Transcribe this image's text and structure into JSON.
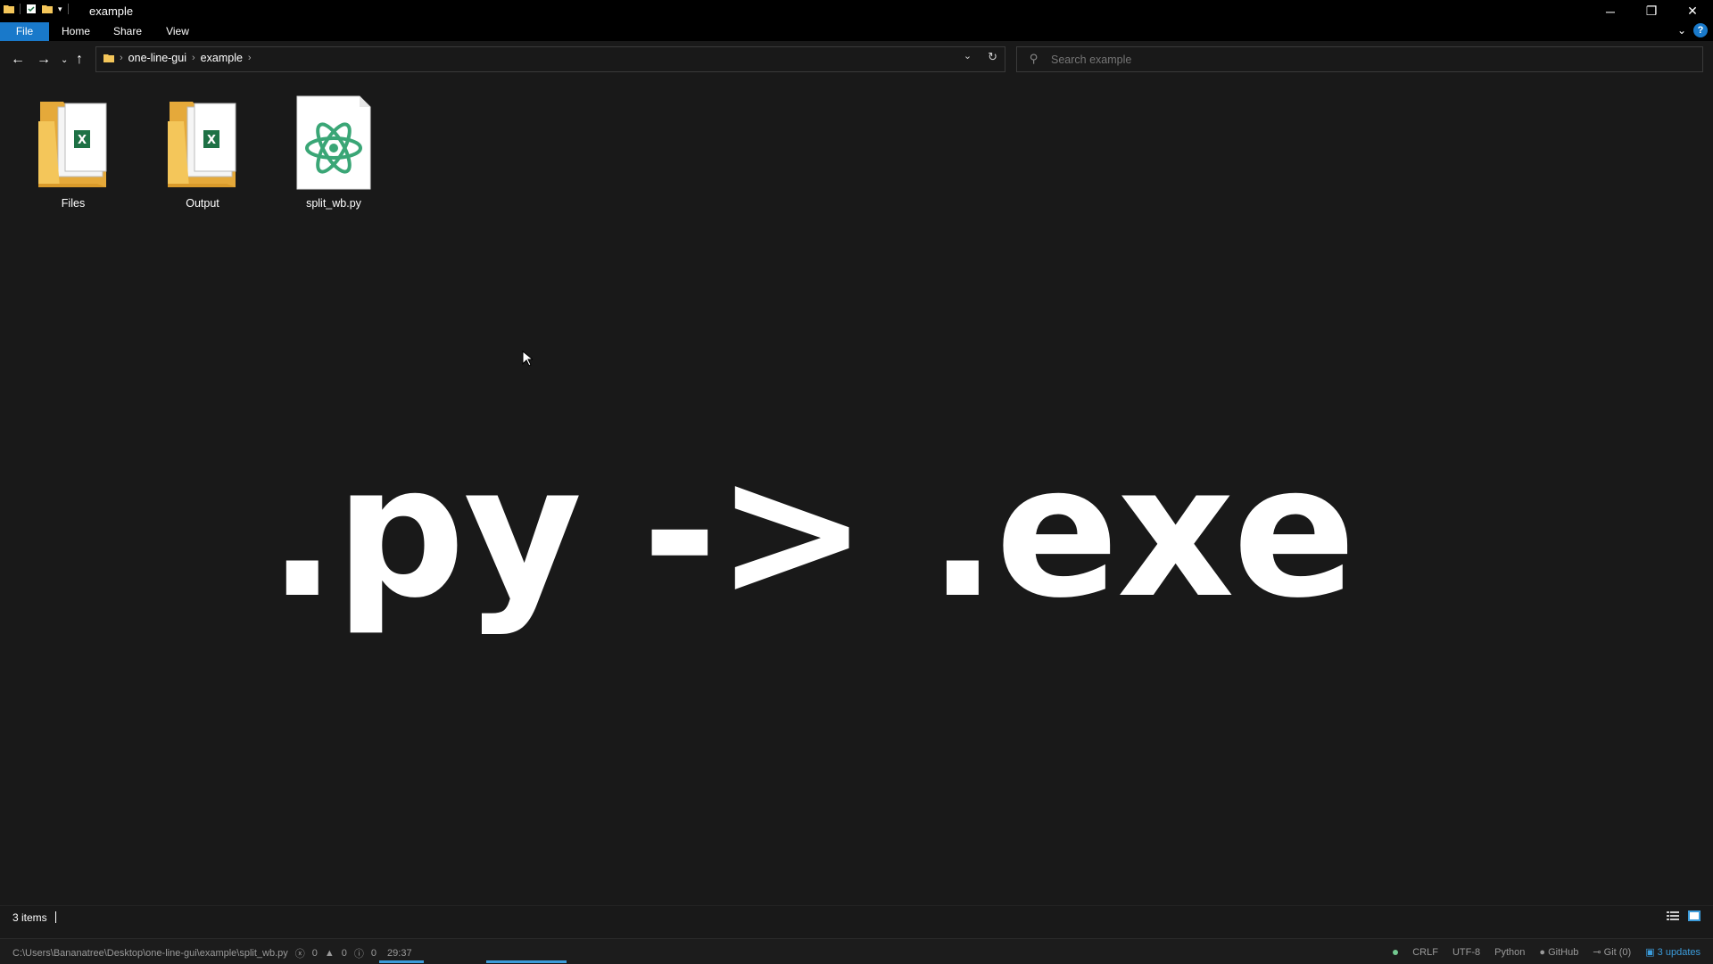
{
  "window": {
    "title": "example",
    "controls": {
      "minimize": "─",
      "restore": "❐",
      "close": "✕"
    }
  },
  "ribbon": {
    "tabs": [
      {
        "label": "File"
      },
      {
        "label": "Home"
      },
      {
        "label": "Share"
      },
      {
        "label": "View"
      }
    ],
    "help": "?"
  },
  "address": {
    "breadcrumbs": [
      "one-line-gui",
      "example"
    ],
    "search_placeholder": "Search example"
  },
  "files": [
    {
      "name": "Files",
      "type": "folder"
    },
    {
      "name": "Output",
      "type": "folder"
    },
    {
      "name": "split_wb.py",
      "type": "python-file"
    }
  ],
  "overlay": {
    "text": ".py -> .exe"
  },
  "status": {
    "item_count": "3 items"
  },
  "editor_status": {
    "path": "C:\\Users\\Bananatree\\Desktop\\one-line-gui\\example\\split_wb.py",
    "errors": "0",
    "warnings": "0",
    "infos": "0",
    "cursor": "29:37",
    "line_ending": "CRLF",
    "encoding": "UTF-8",
    "grammar": "Python",
    "github": "GitHub",
    "git": "Git (0)",
    "updates": "3 updates"
  },
  "colors": {
    "accent": "#1979ca",
    "background": "#191919",
    "excel_green": "#1e7145",
    "atom_green": "#3aa676",
    "folder_yellow": "#f4c65a"
  }
}
